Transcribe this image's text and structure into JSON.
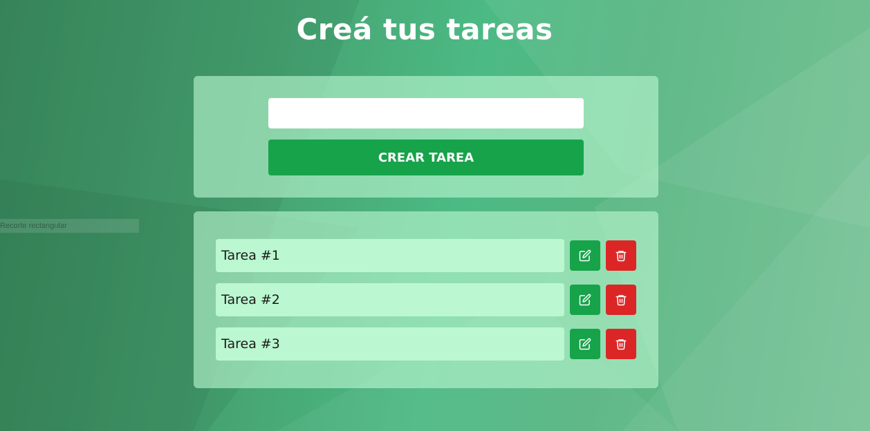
{
  "header": {
    "title": "Creá tus tareas"
  },
  "create_form": {
    "input_value": "",
    "input_placeholder": "",
    "button_label": "CREAR TAREA"
  },
  "tasks": [
    {
      "label": "Tarea #1",
      "edit_icon": "edit-icon",
      "delete_icon": "trash-icon"
    },
    {
      "label": "Tarea #2",
      "edit_icon": "edit-icon",
      "delete_icon": "trash-icon"
    },
    {
      "label": "Tarea #3",
      "edit_icon": "edit-icon",
      "delete_icon": "trash-icon"
    }
  ],
  "overlay": {
    "snip_label": "Recorte rectangular"
  },
  "colors": {
    "primary_green": "#16a34a",
    "danger_red": "#dc2626",
    "task_bg": "#bbf7d0",
    "panel_bg": "#bbf7d0"
  }
}
